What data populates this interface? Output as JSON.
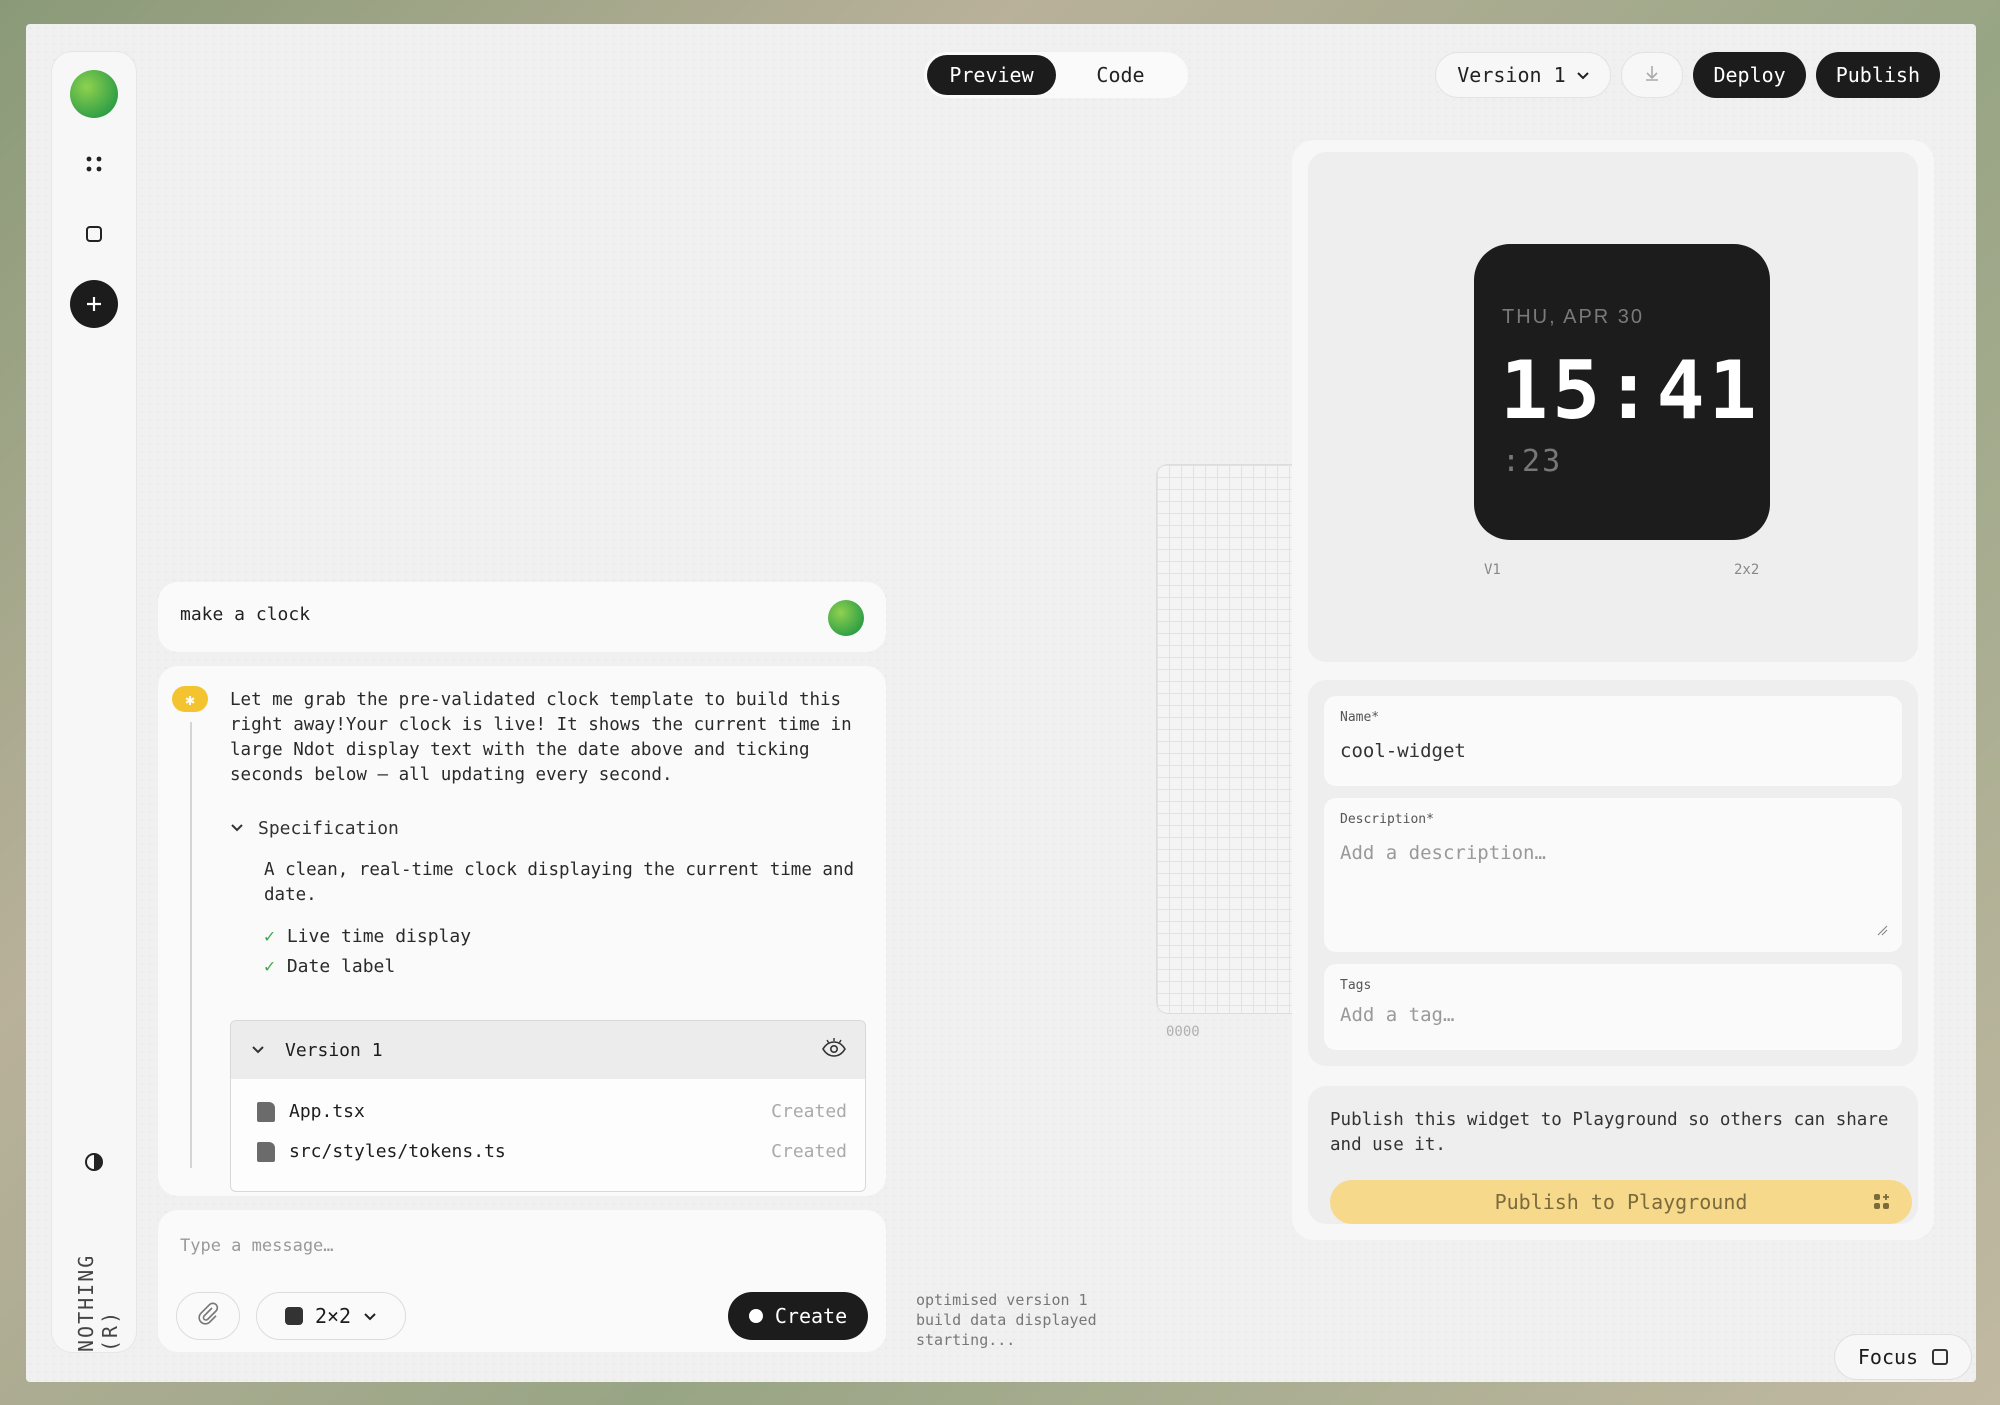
{
  "toolbar": {
    "preview_label": "Preview",
    "code_label": "Code",
    "version_label": "Version 1",
    "deploy_label": "Deploy",
    "publish_label": "Publish"
  },
  "sidebar": {
    "brand": "NOTHING (R)"
  },
  "chat": {
    "user_prompt": "make a clock",
    "assistant_message": "Let me grab the pre-validated clock template to build this right away!Your clock is live! It shows the current time in large Ndot display text with the date above and ticking seconds below — all updating every second.",
    "spec_title": "Specification",
    "spec_description": "A clean, real-time clock displaying the current time and date.",
    "spec_items": [
      "Live time display",
      "Date label"
    ],
    "version_title": "Version 1",
    "files": [
      {
        "name": "App.tsx",
        "status": "Created"
      },
      {
        "name": "src/styles/tokens.ts",
        "status": "Created"
      }
    ],
    "input_placeholder": "Type a message…",
    "size_label": "2×2",
    "create_label": "Create"
  },
  "canvas": {
    "grid_label": "0000",
    "log_lines": [
      "optimised version 1",
      "build data displayed",
      "starting..."
    ]
  },
  "widget_preview": {
    "date": "THU, APR 30",
    "time": "15:41",
    "seconds": ":23",
    "version_tag": "V1",
    "size_tag": "2x2"
  },
  "publish_form": {
    "name_label": "Name*",
    "name_value": "cool-widget",
    "description_label": "Description*",
    "description_placeholder": "Add a description…",
    "tags_label": "Tags",
    "tags_placeholder": "Add a tag…",
    "publish_note": "Publish this widget to Playground so others can share and use it.",
    "publish_button": "Publish to Playground"
  },
  "focus_label": "Focus",
  "colors": {
    "accent_dark": "#1c1c1c",
    "publish_yellow": "#f6d98a",
    "check_green": "#3aa84a"
  }
}
